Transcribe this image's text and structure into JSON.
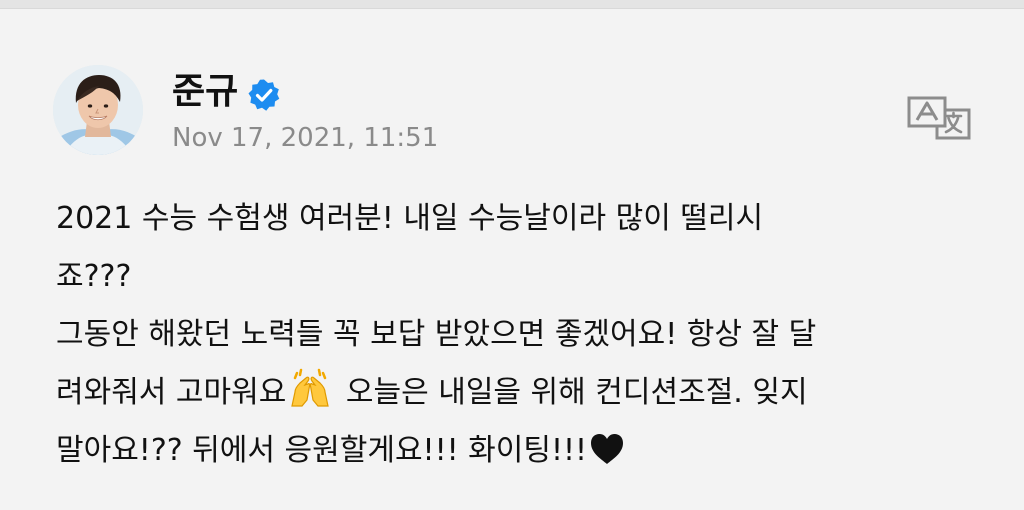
{
  "post": {
    "author": {
      "name": "준규",
      "verified": true,
      "avatar_icon": "profile-photo"
    },
    "timestamp": "Nov 17, 2021, 11:51",
    "translate_icon": "translate-icon",
    "body": {
      "line1": "2021 수능 수험생 여러분! 내일 수능날이라 많이 떨리시",
      "line2": "죠???",
      "line3": "그동안 해왔던 노력들 꼭 보답 받았으면 좋겠어요! 항상 잘 달",
      "line4_part1": "려와줘서 고마워요",
      "line4_emoji": "🙌",
      "line4_part2": " 오늘은 내일을 위해 컨디션조절. 잊지",
      "line5_part1": "말아요!?? 뒤에서 응원할게요!!! 화이팅!!!",
      "line5_emoji": "🖤"
    }
  },
  "colors": {
    "background": "#f3f3f3",
    "text": "#111111",
    "muted": "#8a8a8a",
    "verified_blue": "#1d8cf0",
    "icon_gray": "#8c8c8c"
  }
}
